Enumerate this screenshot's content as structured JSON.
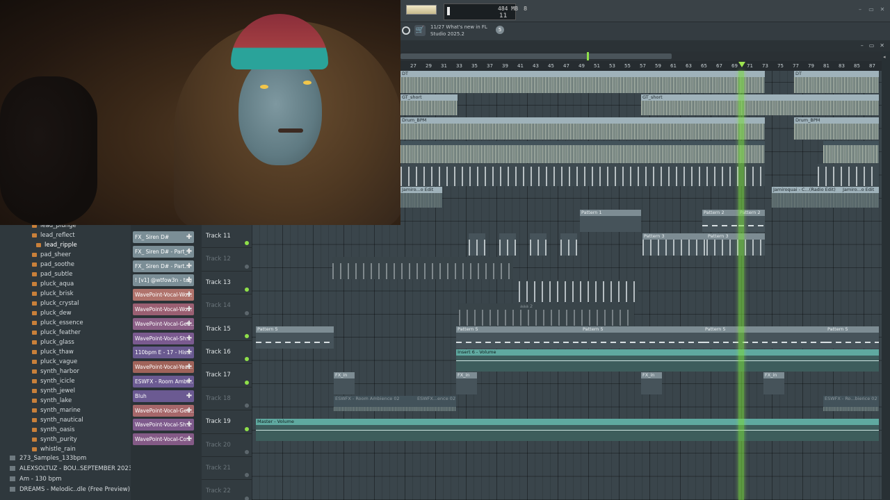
{
  "topbar": {
    "meter_value": "8",
    "memory": "484 MB",
    "cpu": "11",
    "news_line1": "11/27  What's new in FL",
    "news_line2": "Studio 2025.2",
    "news_badge": "5"
  },
  "ruler": [
    "27",
    "29",
    "31",
    "33",
    "35",
    "37",
    "39",
    "41",
    "43",
    "45",
    "47",
    "49",
    "51",
    "53",
    "55",
    "57",
    "59",
    "61",
    "63",
    "65",
    "67",
    "69",
    "71",
    "73",
    "75",
    "77",
    "79",
    "81",
    "83",
    "85",
    "87"
  ],
  "tracks": [
    {
      "name": "Track 11",
      "active": true
    },
    {
      "name": "Track 12",
      "active": false
    },
    {
      "name": "Track 13",
      "active": true
    },
    {
      "name": "Track 14",
      "active": false
    },
    {
      "name": "Track 15",
      "active": true
    },
    {
      "name": "Track 16",
      "active": true
    },
    {
      "name": "Track 17",
      "active": true
    },
    {
      "name": "Track 18",
      "active": false
    },
    {
      "name": "Track 19",
      "active": true
    },
    {
      "name": "Track 20",
      "active": false
    },
    {
      "name": "Track 21",
      "active": false
    },
    {
      "name": "Track 22",
      "active": false
    }
  ],
  "clips": {
    "dt": "DT",
    "gt_short": "GT_short",
    "drum": "Drum_BPM",
    "jamiro": "Jamiro...o Edit",
    "jamiroquai": "Jamiroquai - C...(Radio Edit)",
    "pattern1": "Pattern 1",
    "pattern2": "Pattern 2",
    "pattern3": "Pattern 3",
    "pattern5": "Pattern 5",
    "insert6": "Insert 6 - Volume",
    "fx_in": "FX_in",
    "eswfx1": "ESWFX - Room Ambience 02",
    "eswfx2": "ESWFX...ence 02",
    "eswfx3": "ESWFX - Ro...bience 02",
    "master": "Master - Volume",
    "aaa": "aaa 2"
  },
  "browser": {
    "items": [
      {
        "label": "lead_plunge",
        "selected": false
      },
      {
        "label": "lead_reflect",
        "selected": false
      },
      {
        "label": "lead_ripple",
        "selected": true
      },
      {
        "label": "pad_sheer",
        "selected": false
      },
      {
        "label": "pad_soothe",
        "selected": false
      },
      {
        "label": "pad_subtle",
        "selected": false
      },
      {
        "label": "pluck_aqua",
        "selected": false
      },
      {
        "label": "pluck_brisk",
        "selected": false
      },
      {
        "label": "pluck_crystal",
        "selected": false
      },
      {
        "label": "pluck_dew",
        "selected": false
      },
      {
        "label": "pluck_essence",
        "selected": false
      },
      {
        "label": "pluck_feather",
        "selected": false
      },
      {
        "label": "pluck_glass",
        "selected": false
      },
      {
        "label": "pluck_thaw",
        "selected": false
      },
      {
        "label": "pluck_vague",
        "selected": false
      },
      {
        "label": "synth_harbor",
        "selected": false
      },
      {
        "label": "synth_icicle",
        "selected": false
      },
      {
        "label": "synth_jewel",
        "selected": false
      },
      {
        "label": "synth_lake",
        "selected": false
      },
      {
        "label": "synth_marine",
        "selected": false
      },
      {
        "label": "synth_nautical",
        "selected": false
      },
      {
        "label": "synth_oasis",
        "selected": false
      },
      {
        "label": "synth_purity",
        "selected": false
      },
      {
        "label": "whistle_rain",
        "selected": false
      }
    ],
    "folders": [
      "273_Samples_133bpm",
      "ALEXSOLTUZ - BOU..SEPTEMBER 2023 )",
      "Am - 130 bpm",
      "DREAMS - Melodic..dle (Free Preview)"
    ]
  },
  "picker": [
    {
      "label": "FX_ Siren D#",
      "color": "#7b8e96"
    },
    {
      "label": "FX_ Siren D# - Part_1",
      "color": "#7b8e96"
    },
    {
      "label": "FX_ Siren D# - Part...",
      "color": "#7b8e96"
    },
    {
      "label": "! [v1] @wtfow3n - tag",
      "color": "#7b8e96"
    },
    {
      "label": "WavePoint-Vocal-Wo...",
      "color": "#b0736c"
    },
    {
      "label": "WavePoint-Vocal-Wo...",
      "color": "#9a5f72"
    },
    {
      "label": "WavePoint-Vocal-Get...",
      "color": "#8b5f86"
    },
    {
      "label": "WavePoint-Vocal-Sh...",
      "color": "#7a5a8f"
    },
    {
      "label": "110bpm E - 17 - His...",
      "color": "#6a5a90"
    },
    {
      "label": "WavePoint-Vocal-Yea...",
      "color": "#a0635a"
    },
    {
      "label": "ESWFX - Room Ambi...",
      "color": "#6b5a92"
    },
    {
      "label": "Bluh",
      "color": "#6b5a92"
    },
    {
      "label": "WavePoint-Vocal-Get...",
      "color": "#a6676a"
    },
    {
      "label": "WavePoint-Vocal-Sh...",
      "color": "#7e5a8c"
    },
    {
      "label": "WavePoint-Vocal-Co...",
      "color": "#845a86"
    }
  ]
}
